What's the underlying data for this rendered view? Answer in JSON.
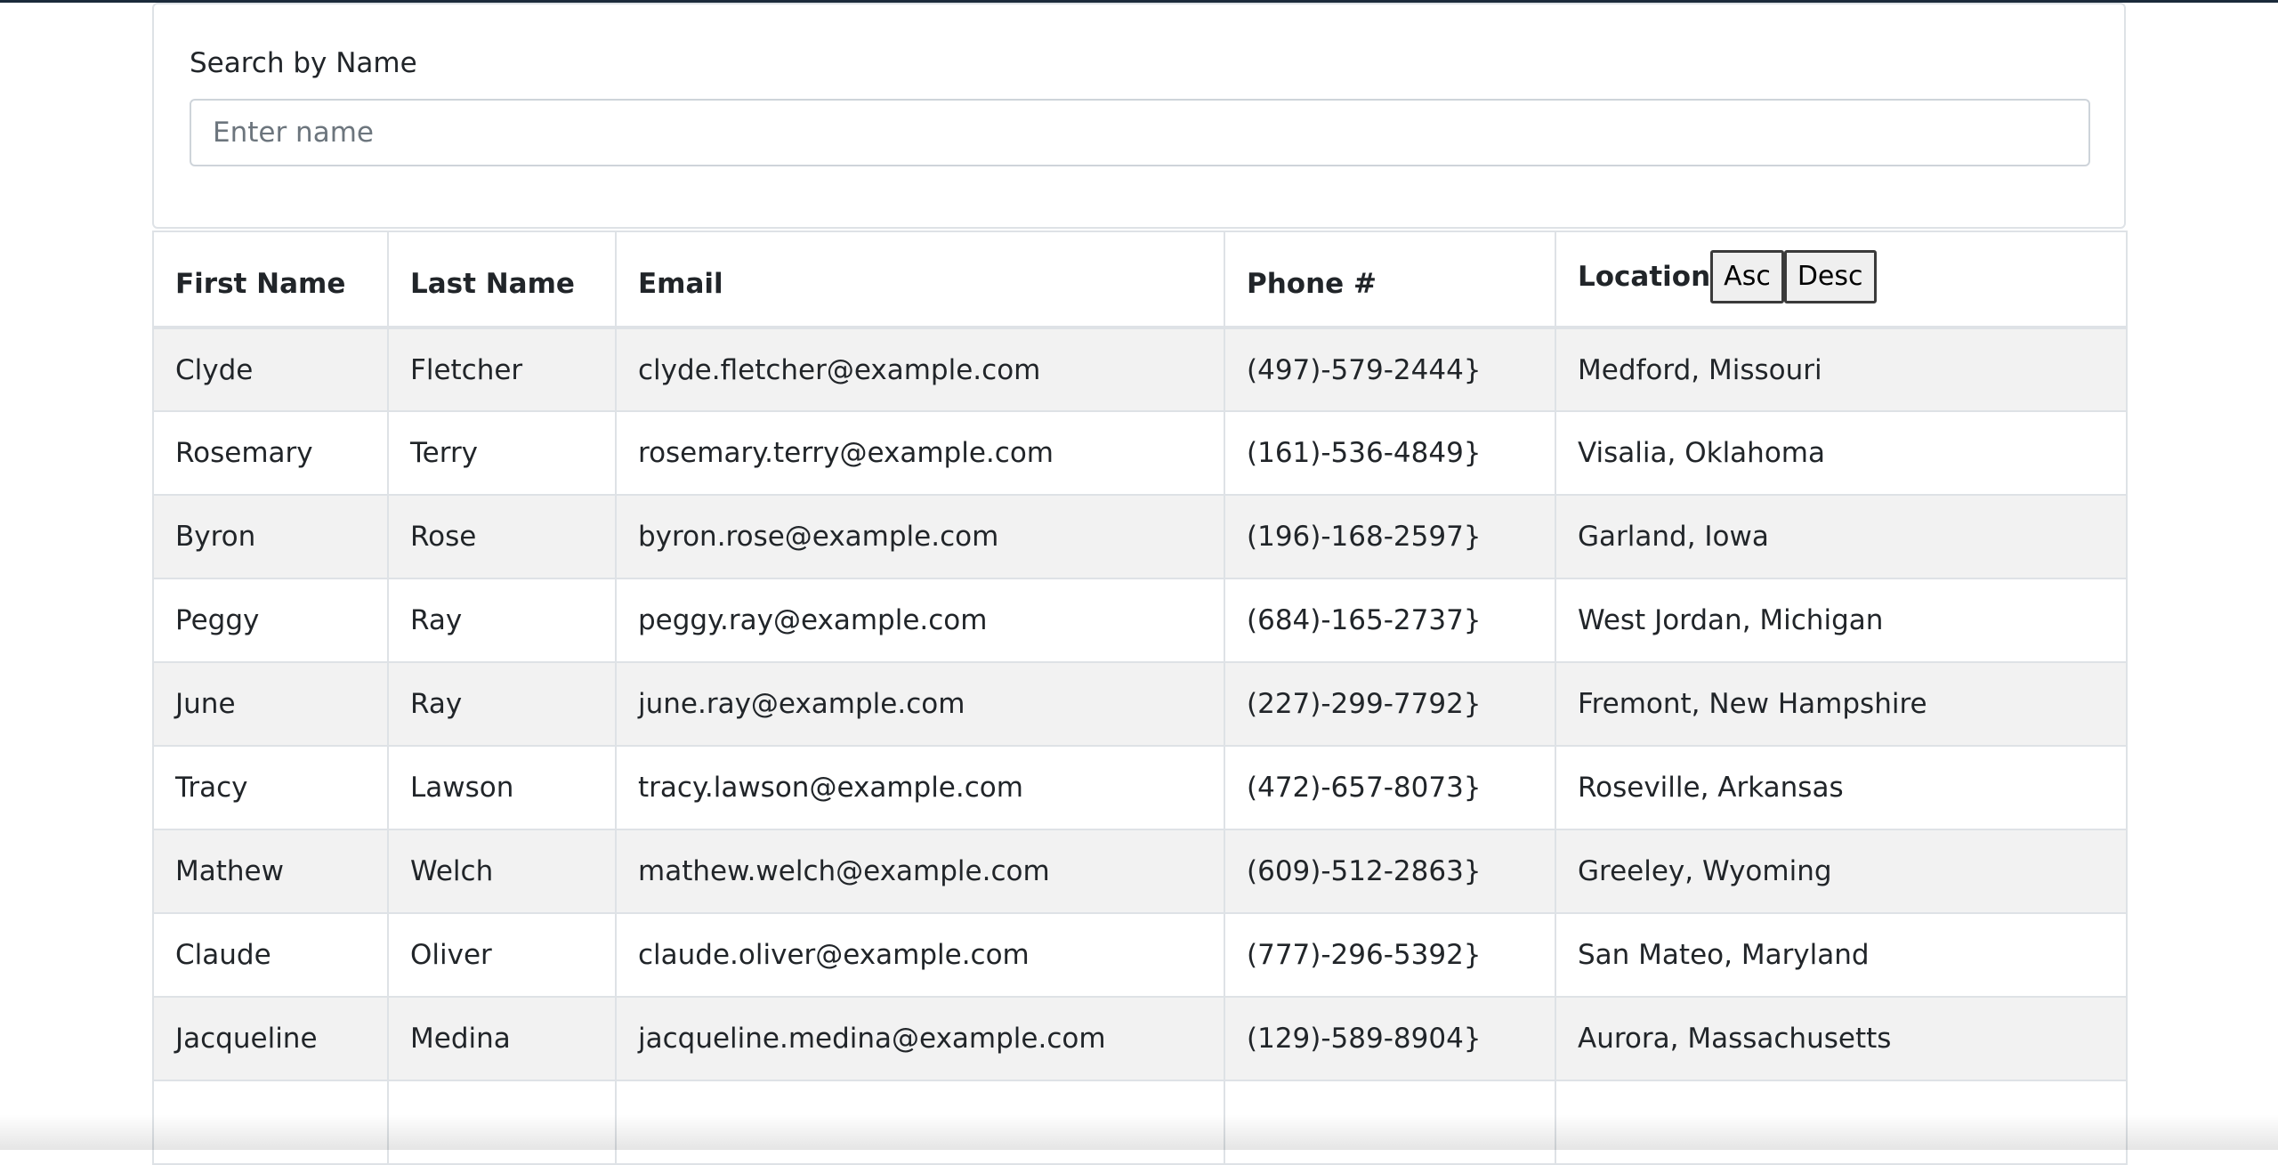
{
  "search": {
    "label": "Search by Name",
    "placeholder": "Enter name",
    "value": ""
  },
  "table": {
    "headers": {
      "first_name": "First Name",
      "last_name": "Last Name",
      "email": "Email",
      "phone": "Phone #",
      "location": "Location"
    },
    "sort": {
      "asc_label": "Asc",
      "desc_label": "Desc"
    },
    "rows": [
      {
        "first": "Clyde",
        "last": "Fletcher",
        "email": "clyde.fletcher@example.com",
        "phone": "(497)-579-2444}",
        "location": "Medford, Missouri"
      },
      {
        "first": "Rosemary",
        "last": "Terry",
        "email": "rosemary.terry@example.com",
        "phone": "(161)-536-4849}",
        "location": "Visalia, Oklahoma"
      },
      {
        "first": "Byron",
        "last": "Rose",
        "email": "byron.rose@example.com",
        "phone": "(196)-168-2597}",
        "location": "Garland, Iowa"
      },
      {
        "first": "Peggy",
        "last": "Ray",
        "email": "peggy.ray@example.com",
        "phone": "(684)-165-2737}",
        "location": "West Jordan, Michigan"
      },
      {
        "first": "June",
        "last": "Ray",
        "email": "june.ray@example.com",
        "phone": "(227)-299-7792}",
        "location": "Fremont, New Hampshire"
      },
      {
        "first": "Tracy",
        "last": "Lawson",
        "email": "tracy.lawson@example.com",
        "phone": "(472)-657-8073}",
        "location": "Roseville, Arkansas"
      },
      {
        "first": "Mathew",
        "last": "Welch",
        "email": "mathew.welch@example.com",
        "phone": "(609)-512-2863}",
        "location": "Greeley, Wyoming"
      },
      {
        "first": "Claude",
        "last": "Oliver",
        "email": "claude.oliver@example.com",
        "phone": "(777)-296-5392}",
        "location": "San Mateo, Maryland"
      },
      {
        "first": "Jacqueline",
        "last": "Medina",
        "email": "jacqueline.medina@example.com",
        "phone": "(129)-589-8904}",
        "location": "Aurora, Massachusetts"
      },
      {
        "first": "",
        "last": "",
        "email": "",
        "phone": "",
        "location": ""
      }
    ]
  }
}
